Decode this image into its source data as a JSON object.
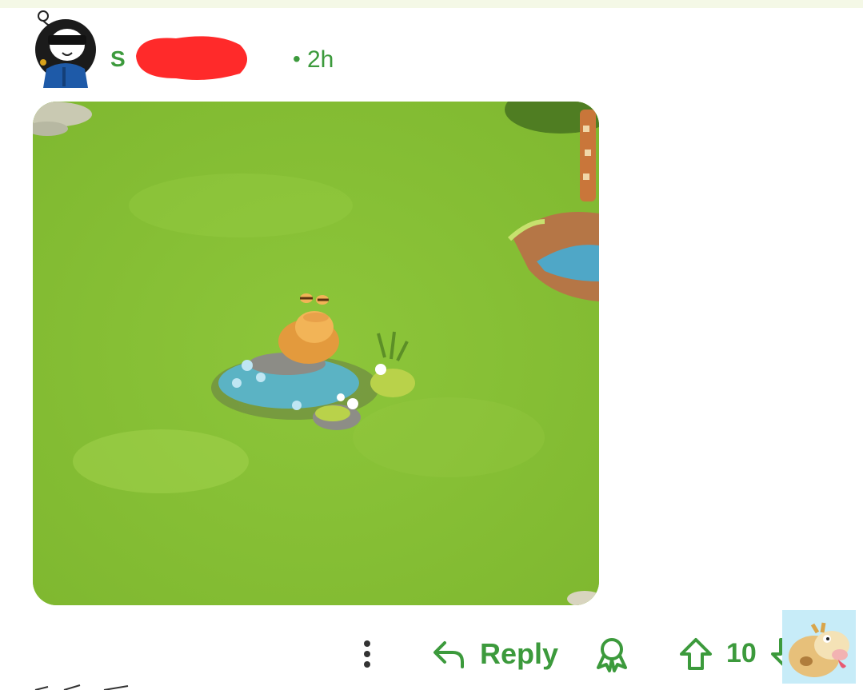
{
  "comment": {
    "username": "S             OP",
    "separator": "•",
    "time_ago": "2h",
    "user_avatar_icon": "snoo-sunglasses-avatar-icon",
    "image_icon": "game-screenshot-toad-pond"
  },
  "actions": {
    "more_icon": "more-vertical-icon",
    "reply_icon": "reply-arrow-icon",
    "reply_label": "Reply",
    "award_icon": "award-icon",
    "upvote_icon": "upvote-arrow-icon",
    "score": "10",
    "downvote_icon": "downvote-arrow-icon"
  },
  "colors": {
    "accent": "#3c9a3c",
    "grass": "#87c235",
    "redaction": "#ff2a2a"
  }
}
